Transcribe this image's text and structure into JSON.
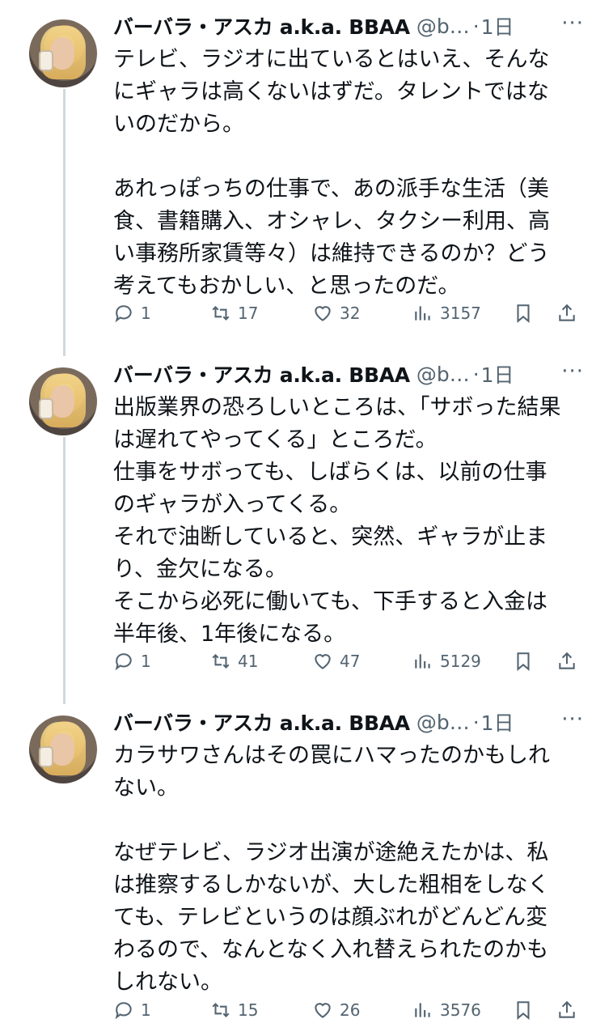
{
  "tweets": [
    {
      "author_name": "バーバラ・アスカ a.k.a. BBAA",
      "handle": "@b…",
      "separator": "·",
      "time": "1日",
      "more": "···",
      "paragraphs": [
        "テレビ、ラジオに出ているとはいえ、そんなにギャラは高くないはずだ。タレントではないのだから。",
        "",
        "あれっぽっちの仕事で、あの派手な生活（美食、書籍購入、オシャレ、タクシー利用、高い事務所家賃等々）は維持できるのか？どう考えてもおかしい、と思ったのだ。"
      ],
      "replies": "1",
      "retweets": "17",
      "likes": "32",
      "views": "3157"
    },
    {
      "author_name": "バーバラ・アスカ a.k.a. BBAA",
      "handle": "@b…",
      "separator": "·",
      "time": "1日",
      "more": "···",
      "paragraphs": [
        "出版業界の恐ろしいところは、「サボった結果は遅れてやってくる」ところだ。",
        "仕事をサボっても、しばらくは、以前の仕事のギャラが入ってくる。",
        "それで油断していると、突然、ギャラが止まり、金欠になる。",
        "そこから必死に働いても、下手すると入金は半年後、1年後になる。"
      ],
      "replies": "1",
      "retweets": "41",
      "likes": "47",
      "views": "5129"
    },
    {
      "author_name": "バーバラ・アスカ a.k.a. BBAA",
      "handle": "@b…",
      "separator": "·",
      "time": "1日",
      "more": "···",
      "paragraphs": [
        "カラサワさんはその罠にハマったのかもしれない。",
        "",
        "なぜテレビ、ラジオ出演が途絶えたかは、私は推察するしかないが、大した粗相をしなくても、テレビというのは顔ぶれがどんどん変わるので、なんとなく入れ替えられたのかもしれない。"
      ],
      "replies": "1",
      "retweets": "15",
      "likes": "26",
      "views": "3576"
    }
  ],
  "icons": [
    "reply-icon",
    "retweet-icon",
    "like-icon",
    "views-icon",
    "bookmark-icon",
    "share-icon"
  ],
  "colors": {
    "text": "#0f1419",
    "secondary": "#536471",
    "thread_line": "#cfd9de"
  }
}
